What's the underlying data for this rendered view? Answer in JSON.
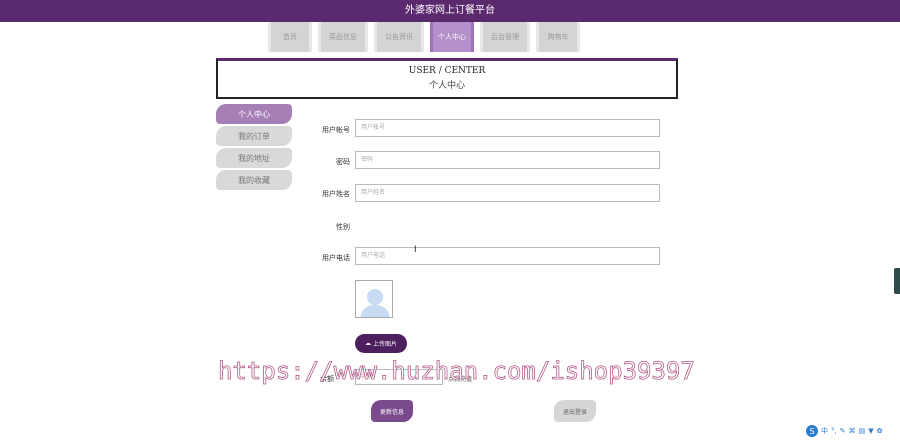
{
  "app": {
    "title": "外婆家网上订餐平台"
  },
  "nav": {
    "tabs": [
      {
        "label": "首页"
      },
      {
        "label": "菜品信息"
      },
      {
        "label": "公告资讯"
      },
      {
        "label": "个人中心",
        "active": true
      },
      {
        "label": "后台管理"
      },
      {
        "label": "购物车"
      }
    ]
  },
  "heading": {
    "en": "USER / CENTER",
    "zh": "个人中心"
  },
  "sidebar": {
    "items": [
      {
        "label": "个人中心",
        "active": true
      },
      {
        "label": "我的订单"
      },
      {
        "label": "我的地址"
      },
      {
        "label": "我的收藏"
      }
    ]
  },
  "form": {
    "account": {
      "label": "用户帐号",
      "placeholder": "用户帐号"
    },
    "password": {
      "label": "密码",
      "placeholder": "密码"
    },
    "name": {
      "label": "用户姓名",
      "placeholder": "用户姓名"
    },
    "gender": {
      "label": "性别"
    },
    "phone": {
      "label": "用户电话",
      "placeholder": "用户电话"
    },
    "upload_label": "上传图片",
    "balance": {
      "label": "余额",
      "value": "余额",
      "recharge": "点我充值"
    },
    "update_label": "更新信息",
    "logout_label": "退出登录"
  },
  "watermark": {
    "text": "https://www.huzhan.com/ishop39397"
  },
  "tray": {
    "items": [
      "中",
      "°,",
      "✎",
      "⌘",
      "▤",
      "▼",
      "✿"
    ]
  },
  "colors": {
    "brand": "#5b2a6e",
    "active_tab": "#b58fc9",
    "sidebar_active": "#a67fb7"
  }
}
